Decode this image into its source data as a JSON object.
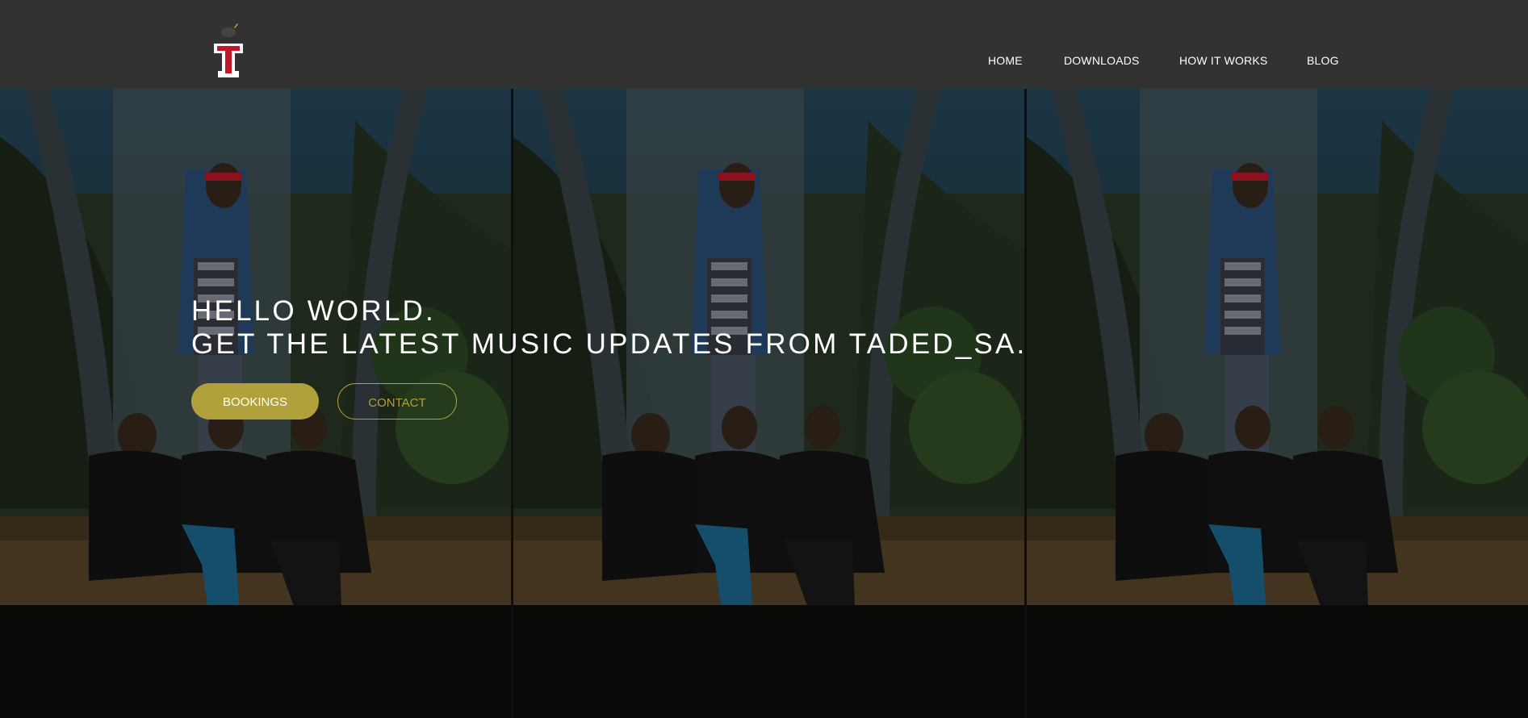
{
  "brand": {
    "logo_icon": "taded-t-logo-icon",
    "logo_letter": "T"
  },
  "nav": {
    "items": [
      {
        "label": "HOME"
      },
      {
        "label": "DOWNLOADS"
      },
      {
        "label": "HOW IT WORKS"
      },
      {
        "label": "BLOG"
      }
    ]
  },
  "hero": {
    "line1": "HELLO WORLD.",
    "line2": "GET THE LATEST MUSIC UPDATES FROM TADED_SA.",
    "background": "group-photo-tiled-3x",
    "buttons": {
      "bookings": "BOOKINGS",
      "contact": "CONTACT"
    }
  },
  "colors": {
    "navbar": "#323232",
    "accent": "#b1a13a",
    "text": "#ffffff",
    "logo_red": "#c0182a"
  }
}
